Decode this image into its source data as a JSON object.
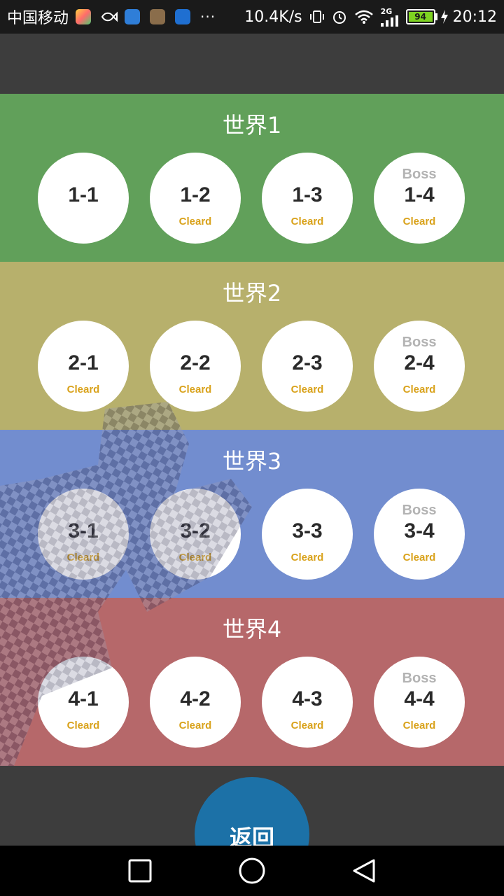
{
  "status_bar": {
    "carrier": "中国移动",
    "dots": "···",
    "speed": "10.4K/s",
    "network": "2G",
    "battery": "94",
    "time": "20:12"
  },
  "back_button": {
    "label": "返回"
  },
  "colors": {
    "world_1": "#61a05a",
    "world_2": "#b7b06c",
    "world_3": "#728dcf",
    "world_4": "#b6686a",
    "back_button": "#1c71a7",
    "cleared_text": "#d9a21b",
    "boss_text": "#b3b3b3"
  },
  "chart_data": {
    "type": "table",
    "worlds": [
      {
        "title": "世界1",
        "levels": [
          {
            "name": "1-1",
            "boss": "",
            "status": ""
          },
          {
            "name": "1-2",
            "boss": "",
            "status": "Cleard"
          },
          {
            "name": "1-3",
            "boss": "",
            "status": "Cleard"
          },
          {
            "name": "1-4",
            "boss": "Boss",
            "status": "Cleard"
          }
        ]
      },
      {
        "title": "世界2",
        "levels": [
          {
            "name": "2-1",
            "boss": "",
            "status": "Cleard"
          },
          {
            "name": "2-2",
            "boss": "",
            "status": "Cleard"
          },
          {
            "name": "2-3",
            "boss": "",
            "status": "Cleard"
          },
          {
            "name": "2-4",
            "boss": "Boss",
            "status": "Cleard"
          }
        ]
      },
      {
        "title": "世界3",
        "levels": [
          {
            "name": "3-1",
            "boss": "",
            "status": "Cleard"
          },
          {
            "name": "3-2",
            "boss": "",
            "status": "Cleard"
          },
          {
            "name": "3-3",
            "boss": "",
            "status": "Cleard"
          },
          {
            "name": "3-4",
            "boss": "Boss",
            "status": "Cleard"
          }
        ]
      },
      {
        "title": "世界4",
        "levels": [
          {
            "name": "4-1",
            "boss": "",
            "status": "Cleard"
          },
          {
            "name": "4-2",
            "boss": "",
            "status": "Cleard"
          },
          {
            "name": "4-3",
            "boss": "",
            "status": "Cleard"
          },
          {
            "name": "4-4",
            "boss": "Boss",
            "status": "Cleard"
          }
        ]
      }
    ]
  }
}
